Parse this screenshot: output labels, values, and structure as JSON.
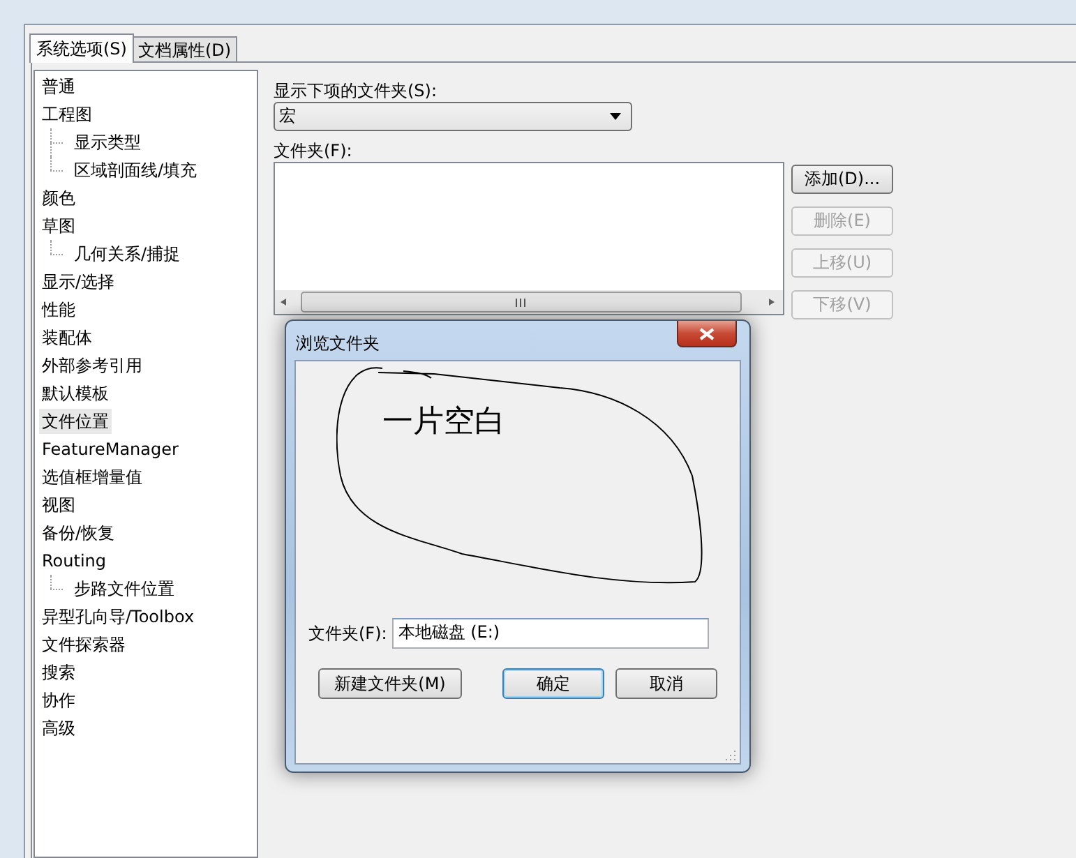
{
  "tabs": [
    {
      "label": "系统选项(S)",
      "selected": true
    },
    {
      "label": "文档属性(D)",
      "selected": false
    }
  ],
  "sidebar": {
    "items": [
      {
        "label": "普通",
        "selected": false
      },
      {
        "label": "工程图",
        "selected": false,
        "children": [
          {
            "label": "显示类型",
            "selected": false
          },
          {
            "label": "区域剖面线/填充",
            "selected": false
          }
        ]
      },
      {
        "label": "颜色",
        "selected": false
      },
      {
        "label": "草图",
        "selected": false,
        "children": [
          {
            "label": "几何关系/捕捉",
            "selected": false
          }
        ]
      },
      {
        "label": "显示/选择",
        "selected": false
      },
      {
        "label": "性能",
        "selected": false
      },
      {
        "label": "装配体",
        "selected": false
      },
      {
        "label": "外部参考引用",
        "selected": false
      },
      {
        "label": "默认模板",
        "selected": false
      },
      {
        "label": "文件位置",
        "selected": true
      },
      {
        "label": "FeatureManager",
        "selected": false
      },
      {
        "label": "选值框增量值",
        "selected": false
      },
      {
        "label": "视图",
        "selected": false
      },
      {
        "label": "备份/恢复",
        "selected": false
      },
      {
        "label": "Routing",
        "selected": false,
        "children": [
          {
            "label": "步路文件位置",
            "selected": false
          }
        ]
      },
      {
        "label": "异型孔向导/Toolbox",
        "selected": false
      },
      {
        "label": "文件探索器",
        "selected": false
      },
      {
        "label": "搜索",
        "selected": false
      },
      {
        "label": "协作",
        "selected": false
      },
      {
        "label": "高级",
        "selected": false
      }
    ]
  },
  "folder_panel": {
    "show_label": "显示下项的文件夹(S):",
    "dropdown": {
      "value": "宏"
    },
    "folders_label": "文件夹(F):",
    "buttons": [
      {
        "label": "添加(D)...",
        "disabled": false
      },
      {
        "label": "删除(E)",
        "disabled": true
      },
      {
        "label": "上移(U)",
        "disabled": true
      },
      {
        "label": "下移(V)",
        "disabled": true
      }
    ]
  },
  "dialog": {
    "title": "浏览文件夹",
    "annotation": "一片空白",
    "folder_label": "文件夹(F):",
    "folder_value": "本地磁盘 (E:)",
    "buttons": [
      {
        "label": "新建文件夹(M)",
        "default": false
      },
      {
        "label": "确定",
        "default": true
      },
      {
        "label": "取消",
        "default": false
      }
    ]
  }
}
